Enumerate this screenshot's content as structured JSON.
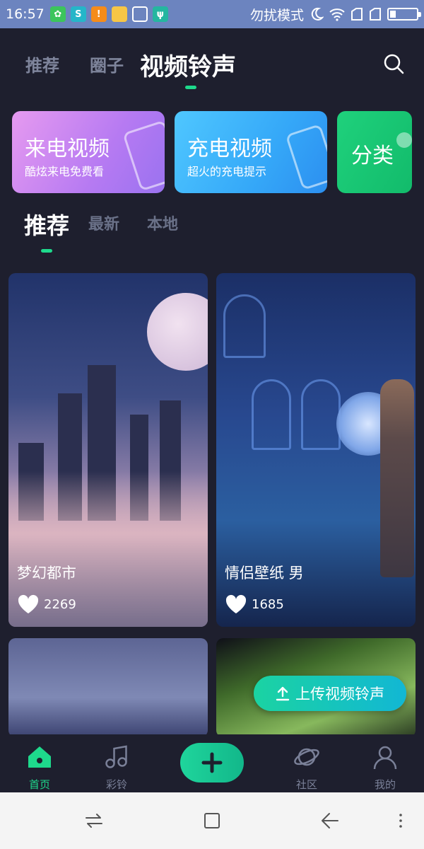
{
  "status_bar": {
    "time": "16:57",
    "mode_text": "勿扰模式",
    "icons": [
      "app-icon",
      "app-icon",
      "warning-icon",
      "folder-icon",
      "brush-icon",
      "usb-icon",
      "moon-icon",
      "wifi-icon",
      "signal-icon",
      "signal-icon",
      "battery-icon"
    ],
    "battery_level": 0.2
  },
  "top_tabs": {
    "items": [
      "推荐",
      "圈子",
      "视频铃声"
    ],
    "active_index": 2
  },
  "feature_cards": [
    {
      "title": "来电视频",
      "subtitle": "酷炫来电免费看"
    },
    {
      "title": "充电视频",
      "subtitle": "超火的充电提示"
    },
    {
      "title": "分类",
      "subtitle": ""
    }
  ],
  "sub_tabs": {
    "items": [
      "推荐",
      "最新",
      "本地"
    ],
    "active_index": 0
  },
  "videos": [
    {
      "title": "梦幻都市",
      "likes": "2269"
    },
    {
      "title": "情侣壁纸 男",
      "likes": "1685"
    },
    {
      "title": "",
      "likes": ""
    },
    {
      "title": "",
      "likes": ""
    }
  ],
  "upload_button": {
    "label": "上传视频铃声"
  },
  "bottom_nav": {
    "items": [
      {
        "label": "首页",
        "icon": "home-icon",
        "active": true
      },
      {
        "label": "彩铃",
        "icon": "music-icon",
        "active": false
      },
      {
        "label": "",
        "icon": "plus-icon",
        "active": false
      },
      {
        "label": "社区",
        "icon": "planet-icon",
        "active": false
      },
      {
        "label": "我的",
        "icon": "user-icon",
        "active": false
      }
    ]
  },
  "colors": {
    "background": "#1e1f2e",
    "accent": "#1ed98c",
    "status_bar": "#6c84bf"
  }
}
